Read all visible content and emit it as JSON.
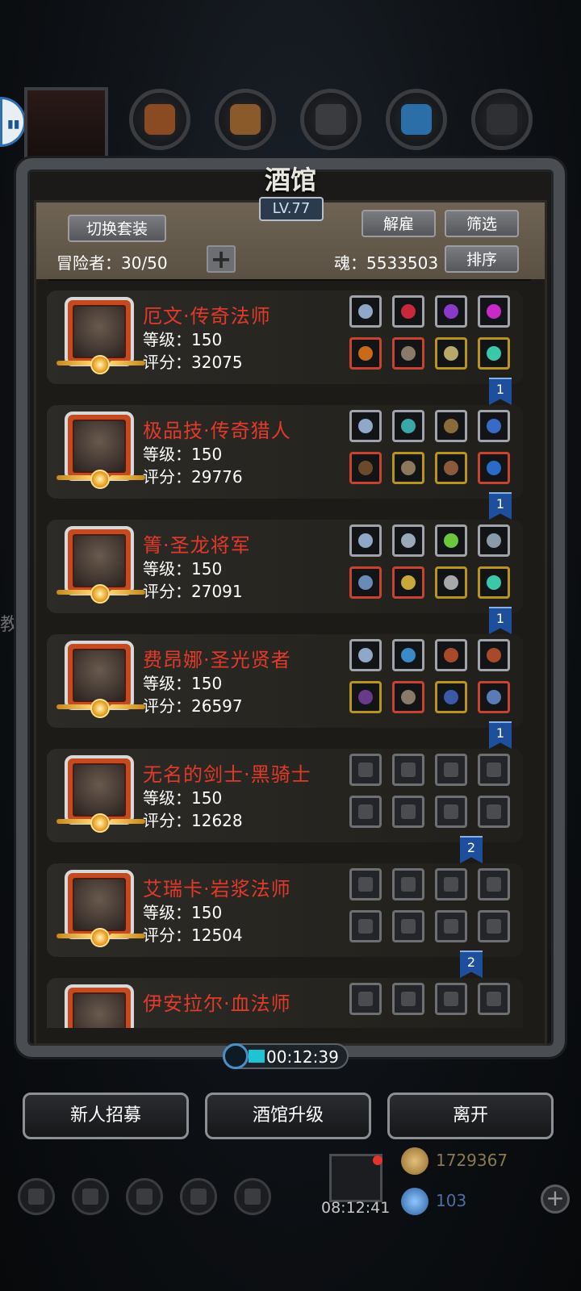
{
  "panel": {
    "title": "酒馆",
    "level": "LV.77",
    "switch_outfit": "切换套装",
    "dismiss": "解雇",
    "filter": "筛选",
    "sort": "排序",
    "adventurers": "冒险者：30/50",
    "add": "+",
    "soul": "魂：5533503"
  },
  "heroes": [
    {
      "name": "厄文·传奇法师",
      "level": "等级：150",
      "score": "评分：32075",
      "rank": "1",
      "slots": "filled"
    },
    {
      "name": "极品技·传奇猎人",
      "level": "等级：150",
      "score": "评分：29776",
      "rank": "1",
      "slots": "filled"
    },
    {
      "name": "箐·圣龙将军",
      "level": "等级：150",
      "score": "评分：27091",
      "rank": "1",
      "slots": "filled"
    },
    {
      "name": "费昂娜·圣光贤者",
      "level": "等级：150",
      "score": "评分：26597",
      "rank": "1",
      "slots": "filled"
    },
    {
      "name": "无名的剑士·黑骑士",
      "level": "等级：150",
      "score": "评分：12628",
      "rank": "2",
      "slots": "empty"
    },
    {
      "name": "艾瑞卡·岩浆法师",
      "level": "等级：150",
      "score": "评分：12504",
      "rank": "2",
      "slots": "empty"
    },
    {
      "name": "伊安拉尔·血法师",
      "level": "",
      "score": "",
      "rank": "",
      "slots": "empty"
    }
  ],
  "timer": "00:12:39",
  "buttons": {
    "recruit": "新人招募",
    "upgrade": "酒馆升级",
    "leave": "离开"
  },
  "bottom": {
    "gift_time": "08:12:41",
    "gold": "1729367",
    "crystal": "103"
  },
  "side_text": "教",
  "colors": {
    "hero_name": "#e23a2a",
    "rank_ribbon": "#1d4f9c",
    "timer_bar": "#1fc3d4"
  }
}
